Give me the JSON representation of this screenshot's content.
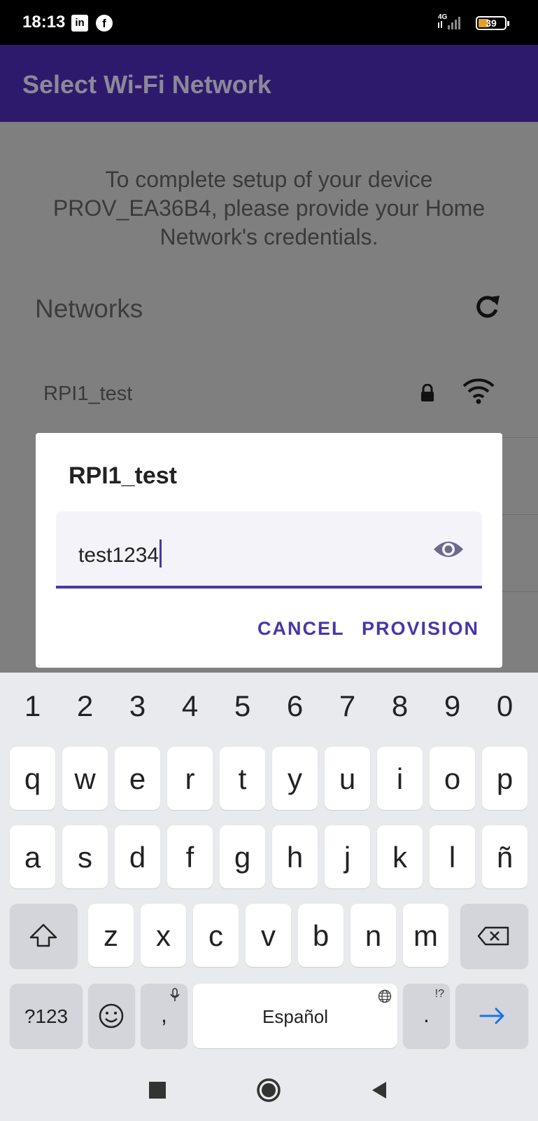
{
  "status_bar": {
    "time": "18:13",
    "app_icons": [
      "linkedin-icon",
      "facebook-icon"
    ],
    "network_type": "4G",
    "battery_level": "39",
    "battery_color": "#e1a126"
  },
  "app_bar": {
    "title": "Select Wi-Fi Network",
    "background_color": "#2e1a6c"
  },
  "content": {
    "intro_text": "To complete setup of your device PROV_EA36B4, please provide your Home Network's credentials.",
    "networks_label": "Networks",
    "refresh_icon": "refresh-icon",
    "networks": [
      {
        "name": "RPI1_test",
        "secured": true,
        "icons": [
          "lock-icon",
          "wifi-icon"
        ]
      }
    ]
  },
  "dialog": {
    "title": "RPI1_test",
    "password_value": "test1234",
    "toggle_icon": "eye-icon",
    "cancel_label": "CANCEL",
    "provision_label": "PROVISION",
    "accent_color": "#4b35a8"
  },
  "keyboard": {
    "number_row": [
      "1",
      "2",
      "3",
      "4",
      "5",
      "6",
      "7",
      "8",
      "9",
      "0"
    ],
    "row1": [
      "q",
      "w",
      "e",
      "r",
      "t",
      "y",
      "u",
      "i",
      "o",
      "p"
    ],
    "row2": [
      "a",
      "s",
      "d",
      "f",
      "g",
      "h",
      "j",
      "k",
      "l",
      "ñ"
    ],
    "row3": [
      "z",
      "x",
      "c",
      "v",
      "b",
      "n",
      "m"
    ],
    "symbols_label": "?123",
    "comma_label": ",",
    "period_label": ".",
    "period_hint": "!?",
    "space_label": "Español",
    "icons": [
      "shift-icon",
      "backspace-icon",
      "emoji-icon",
      "microphone-icon",
      "globe-icon",
      "arrow-right-icon"
    ]
  },
  "nav_bar": {
    "icons": [
      "recents-icon",
      "home-icon",
      "back-icon"
    ]
  }
}
